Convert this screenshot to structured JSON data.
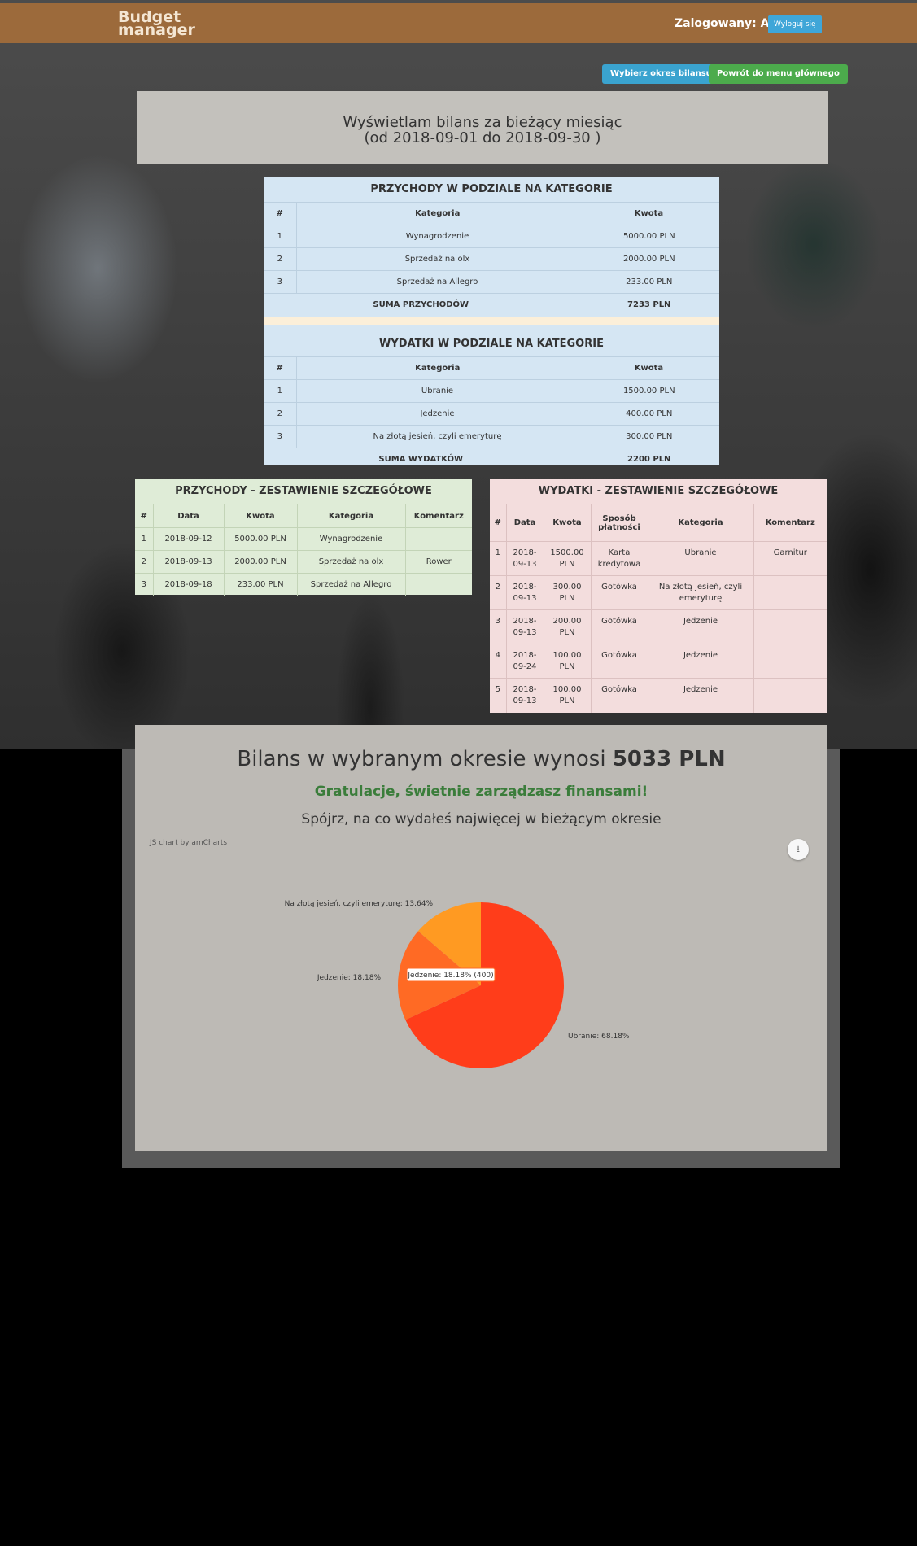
{
  "nav": {
    "brand_line1": "Budget",
    "brand_line2": "manager",
    "logged_in": "Zalogowany: Artur",
    "logout": "Wyloguj się"
  },
  "toolbar": {
    "period": "Wybierz okres bilansu",
    "back": "Powrót do menu głównego"
  },
  "header": {
    "line1": "Wyświetlam bilans za bieżący miesiąc",
    "line2": "(od 2018-09-01 do 2018-09-30 )"
  },
  "income_summary": {
    "title": "PRZYCHODY W PODZIALE NA KATEGORIE",
    "columns": [
      "#",
      "Kategoria",
      "Kwota"
    ],
    "rows": [
      [
        "1",
        "Wynagrodzenie",
        "5000.00 PLN"
      ],
      [
        "2",
        "Sprzedaż na olx",
        "2000.00 PLN"
      ],
      [
        "3",
        "Sprzedaż na Allegro",
        "233.00 PLN"
      ]
    ],
    "total_label": "SUMA PRZYCHODÓW",
    "total_value": "7233 PLN"
  },
  "expense_summary": {
    "title": "WYDATKI W PODZIALE NA KATEGORIE",
    "columns": [
      "#",
      "Kategoria",
      "Kwota"
    ],
    "rows": [
      [
        "1",
        "Ubranie",
        "1500.00 PLN"
      ],
      [
        "2",
        "Jedzenie",
        "400.00 PLN"
      ],
      [
        "3",
        "Na złotą jesień, czyli emeryturę",
        "300.00 PLN"
      ]
    ],
    "total_label": "SUMA WYDATKÓW",
    "total_value": "2200 PLN"
  },
  "income_detail": {
    "title": "PRZYCHODY - ZESTAWIENIE SZCZEGÓŁOWE",
    "columns": [
      "#",
      "Data",
      "Kwota",
      "Kategoria",
      "Komentarz"
    ],
    "rows": [
      [
        "1",
        "2018-09-12",
        "5000.00 PLN",
        "Wynagrodzenie",
        ""
      ],
      [
        "2",
        "2018-09-13",
        "2000.00 PLN",
        "Sprzedaż na olx",
        "Rower"
      ],
      [
        "3",
        "2018-09-18",
        "233.00 PLN",
        "Sprzedaż na Allegro",
        ""
      ]
    ]
  },
  "expense_detail": {
    "title": "WYDATKI - ZESTAWIENIE SZCZEGÓŁOWE",
    "columns": [
      "#",
      "Data",
      "Kwota",
      "Sposób płatności",
      "Kategoria",
      "Komentarz"
    ],
    "rows": [
      [
        "1",
        "2018-09-13",
        "1500.00 PLN",
        "Karta kredytowa",
        "Ubranie",
        "Garnitur"
      ],
      [
        "2",
        "2018-09-13",
        "300.00 PLN",
        "Gotówka",
        "Na złotą jesień, czyli emeryturę",
        ""
      ],
      [
        "3",
        "2018-09-13",
        "200.00 PLN",
        "Gotówka",
        "Jedzenie",
        ""
      ],
      [
        "4",
        "2018-09-24",
        "100.00 PLN",
        "Gotówka",
        "Jedzenie",
        ""
      ],
      [
        "5",
        "2018-09-13",
        "100.00 PLN",
        "Gotówka",
        "Jedzenie",
        ""
      ]
    ]
  },
  "balance": {
    "text": "Bilans w wybranym okresie wynosi",
    "amount": "5033 PLN",
    "congrats": "Gratulacje, świetnie zarządzasz finansami!",
    "subtitle": "Spójrz, na co wydałeś najwięcej w bieżącym okresie",
    "credit": "JS chart by amCharts"
  },
  "chart_data": {
    "type": "pie",
    "categories": [
      "Ubranie",
      "Jedzenie",
      "Na złotą jesień, czyli emeryturę"
    ],
    "values": [
      1500,
      400,
      300
    ],
    "labels": [
      "Ubranie: 68.18%",
      "Jedzenie: 18.18%",
      "Na złotą jesień, czyli emeryturę: 13.64%"
    ],
    "colors": [
      "#ff3d1a",
      "#ff6a24",
      "#ff9a22"
    ],
    "tooltip": "Jedzenie: 18.18% (400)"
  }
}
